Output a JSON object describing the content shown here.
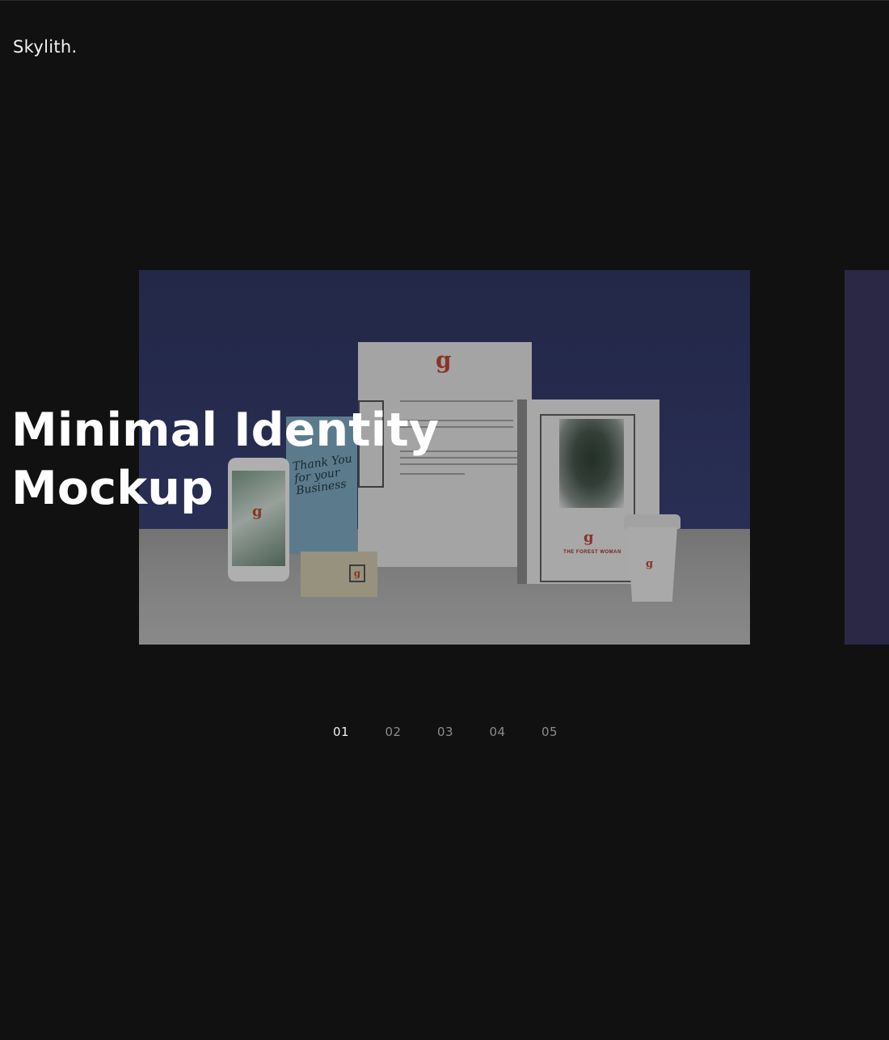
{
  "brand": {
    "logo_text": "Skylith."
  },
  "hero": {
    "title_line1": "Minimal Identity",
    "title_line2": "Mockup"
  },
  "pagination": {
    "items": [
      "01",
      "02",
      "03",
      "04",
      "05"
    ],
    "active_index": 0
  },
  "colors": {
    "background": "#111111",
    "slide_wall": "#2c3256",
    "next_slide": "#2a2845",
    "accent_red": "#a8402f"
  },
  "mockup": {
    "logo_glyph": "g",
    "book_title": "THE FOREST WOMAN",
    "card_script": "Thank You for your Business"
  }
}
